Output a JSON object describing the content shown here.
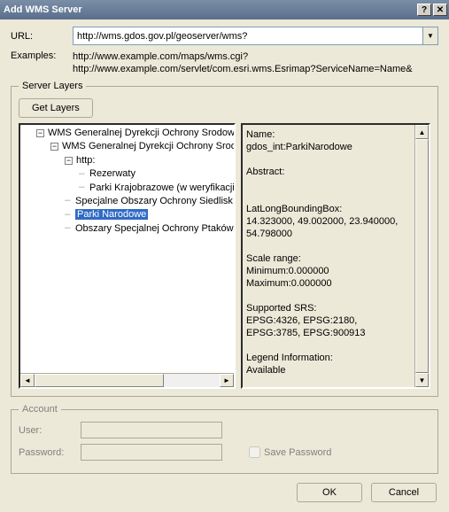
{
  "window": {
    "title": "Add WMS Server",
    "help_icon": "?",
    "close_icon": "✕"
  },
  "url": {
    "label": "URL:",
    "value": "http://wms.gdos.gov.pl/geoserver/wms?"
  },
  "examples": {
    "label": "Examples:",
    "line1": "http://www.example.com/maps/wms.cgi?",
    "line2": "http://www.example.com/servlet/com.esri.wms.Esrimap?ServiceName=Name&"
  },
  "serverLayers": {
    "legend": "Server Layers",
    "getLayersBtn": "Get Layers",
    "tree": {
      "root": "WMS Generalnej Dyrekcji Ochrony Srodowiska",
      "child": "WMS Generalnej Dyrekcji Ochrony Srodowi",
      "http": "http:",
      "http_children": [
        "Rezerwaty",
        "Parki Krajobrazowe (w weryfikacji)"
      ],
      "siblings": [
        "Specjalne Obszary Ochrony Siedlisk",
        "Parki Narodowe",
        "Obszary Specjalnej Ochrony Ptaków"
      ],
      "selected": "Parki Narodowe"
    },
    "details": {
      "name_label": "Name:",
      "name_value": "gdos_int:ParkiNarodowe",
      "abstract_label": "Abstract:",
      "bbox_label": "LatLongBoundingBox:",
      "bbox_value": "14.323000, 49.002000, 23.940000, 54.798000",
      "scale_label": "Scale range:",
      "scale_min": "Minimum:0.000000",
      "scale_max": "Maximum:0.000000",
      "srs_label": "Supported SRS:",
      "srs_value": " EPSG:4326, EPSG:2180, EPSG:3785, EPSG:900913",
      "legend_label": "Legend Information:",
      "legend_value": "Available"
    }
  },
  "account": {
    "legend": "Account",
    "user_label": "User:",
    "user_value": "",
    "password_label": "Password:",
    "password_value": "",
    "save_password_label": "Save Password",
    "save_password_checked": false
  },
  "buttons": {
    "ok": "OK",
    "cancel": "Cancel"
  }
}
